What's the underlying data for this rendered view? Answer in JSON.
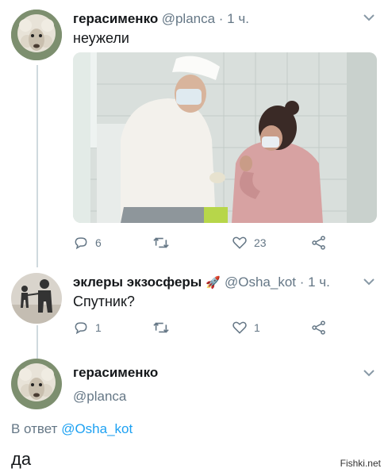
{
  "tweet1": {
    "display_name": "герасименко",
    "handle_time": "@planca · 1 ч.",
    "text": "неужели",
    "replies": "6",
    "retweets": "",
    "likes": "23"
  },
  "tweet2": {
    "display_name": "эклеры экзосферы",
    "emoji": "🚀",
    "handle_time": "@Osha_kot · 1 ч.",
    "text": "Спутник?",
    "replies": "1",
    "retweets": "",
    "likes": "1"
  },
  "tweet3": {
    "display_name": "герасименко",
    "handle": "@planca",
    "reply_prefix": "В ответ",
    "reply_to": "@Osha_kot",
    "text": "да"
  },
  "watermark": "Fishki.net",
  "colors": {
    "secondary": "#657786",
    "link": "#1da1f2",
    "divider": "#e1e8ed"
  },
  "icons": [
    "reply-icon",
    "retweet-icon",
    "like-icon",
    "share-icon",
    "chevron-down-icon",
    "rocket-icon"
  ]
}
